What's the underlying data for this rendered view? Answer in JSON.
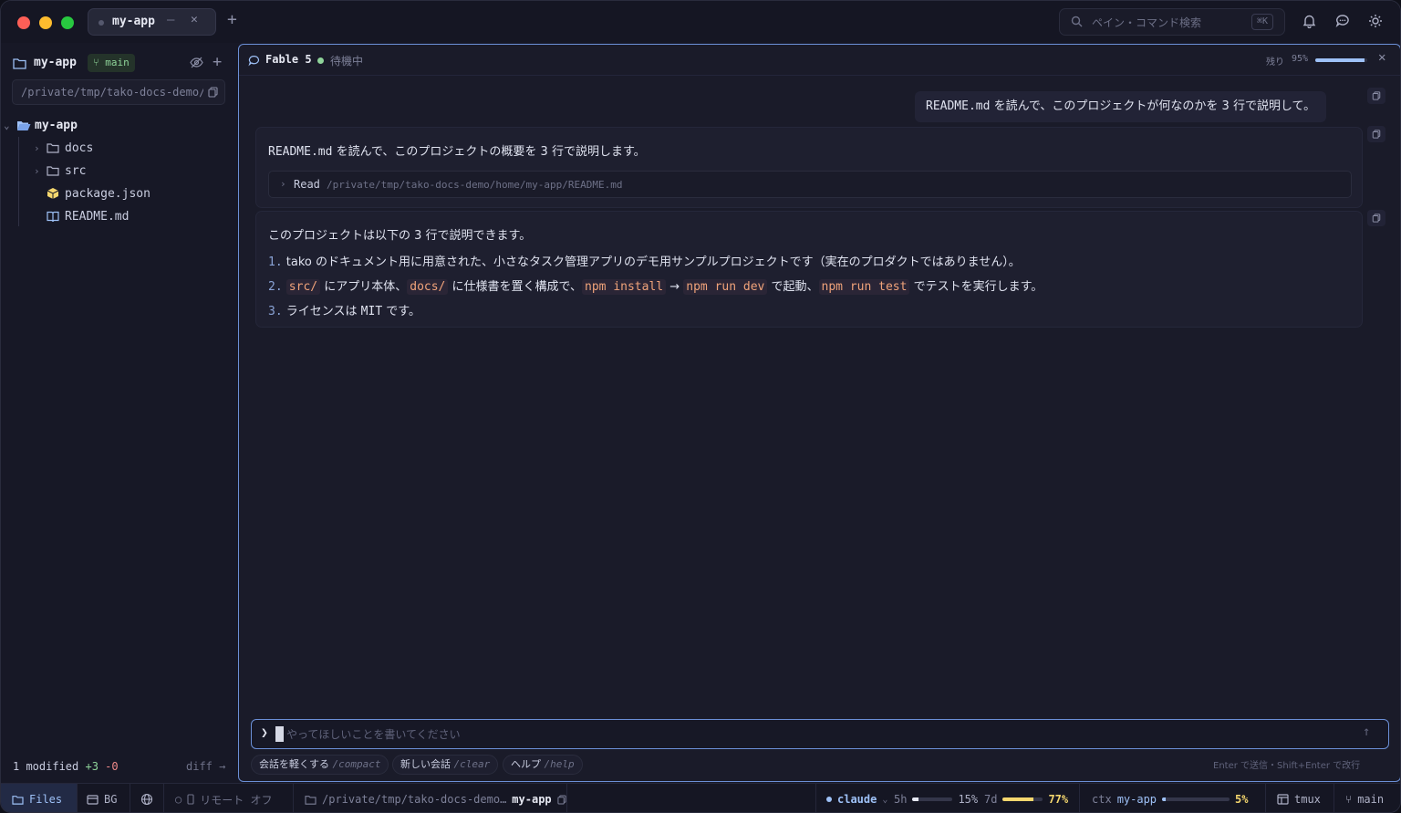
{
  "titlebar": {
    "tab_label": "my-app",
    "tab_min": "—",
    "tab_close": "✕",
    "tab_add": "+",
    "search_placeholder": "ペイン・コマンド検索",
    "search_shortcut": "⌘K"
  },
  "sidebar": {
    "project_name": "my-app",
    "branch": "main",
    "path": "/private/tmp/tako-docs-demo/home/my-app",
    "tree": [
      {
        "label": "my-app",
        "type": "folder-open",
        "depth": 0,
        "chevron": "⌄"
      },
      {
        "label": "docs",
        "type": "folder",
        "depth": 1,
        "chevron": "›"
      },
      {
        "label": "src",
        "type": "folder",
        "depth": 1,
        "chevron": "›"
      },
      {
        "label": "package.json",
        "type": "package",
        "depth": 1,
        "chevron": ""
      },
      {
        "label": "README.md",
        "type": "book",
        "depth": 1,
        "chevron": ""
      }
    ],
    "footer": {
      "modified": "1 modified",
      "added": "+3",
      "removed": "-0",
      "diff": "diff →"
    }
  },
  "pane": {
    "title": "Fable 5",
    "status": "待機中",
    "remaining_label": "残り",
    "remaining_pct": "95%",
    "remaining_value": 0.95,
    "close": "✕",
    "user_message": {
      "code": "README.md",
      "text": " を読んで、このプロジェクトが何なのかを 3 行で説明して。"
    },
    "assistant_intro": {
      "code": "README.md",
      "text": " を読んで、このプロジェクトの概要を 3 行で説明します。"
    },
    "tool": {
      "name": "Read",
      "path": "/private/tmp/tako-docs-demo/home/my-app/README.md"
    },
    "answer": {
      "intro": "このプロジェクトは以下の 3 行で説明できます。",
      "items": [
        {
          "num": "1.",
          "parts": [
            {
              "t": "tako のドキュメント用に用意された、小さなタスク管理アプリのデモ用サンプルプロジェクトです（実在のプロダクトではありません）。"
            }
          ]
        },
        {
          "num": "2.",
          "parts": [
            {
              "c": "src/"
            },
            {
              "t": " にアプリ本体、"
            },
            {
              "c": "docs/"
            },
            {
              "t": " に仕様書を置く構成で、"
            },
            {
              "c": "npm install"
            },
            {
              "t": " → "
            },
            {
              "c": "npm run dev"
            },
            {
              "t": " で起動、"
            },
            {
              "c": "npm run test"
            },
            {
              "t": " でテストを実行します。"
            }
          ]
        },
        {
          "num": "3.",
          "parts": [
            {
              "t": "ライセンスは "
            },
            {
              "tc": "MIT"
            },
            {
              "t": " です。"
            }
          ]
        }
      ]
    },
    "input_placeholder": "やってほしいことを書いてください",
    "prompt": "❯",
    "send": "↑",
    "chips": [
      {
        "label": "会話を軽くする",
        "cmd": "/compact"
      },
      {
        "label": "新しい会話",
        "cmd": "/clear"
      },
      {
        "label": "ヘルプ",
        "cmd": "/help"
      }
    ],
    "hint": "Enter で送信・Shift+Enter で改行"
  },
  "statusbar": {
    "files": "Files",
    "bg": "BG",
    "remote": "リモート オフ",
    "path": "/private/tmp/tako-docs-demo…",
    "project": "my-app",
    "agent": "claude",
    "u5h_label": "5h",
    "u5h_pct": "15%",
    "u5h_value": 0.15,
    "u7d_label": "7d",
    "u7d_pct": "77%",
    "u7d_value": 0.77,
    "ctx_label": "ctx",
    "ctx_project": "my-app",
    "ctx_pct": "5%",
    "ctx_value": 0.05,
    "tmux": "tmux",
    "branch": "main"
  },
  "colors": {
    "accent": "#6b8fd6",
    "green": "#8fd49a",
    "orange": "#f0a37a",
    "yellow": "#f5d76e"
  }
}
